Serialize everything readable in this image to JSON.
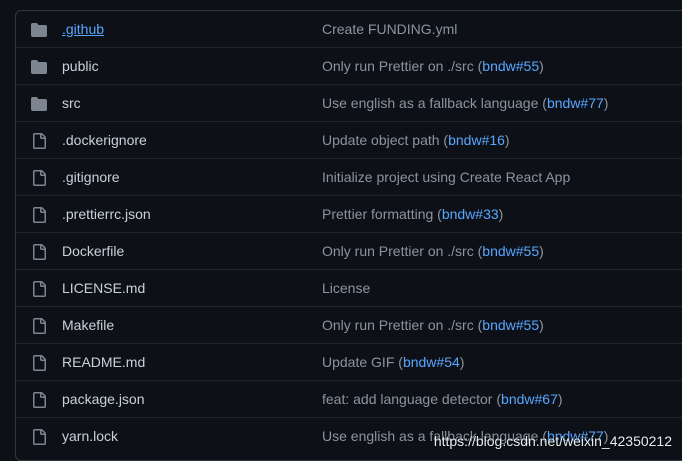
{
  "colors": {
    "background": "#0d1117",
    "border": "#30363d",
    "text": "#c9d1d9",
    "muted": "#8b949e",
    "link": "#58a6ff",
    "folder_icon": "#7d8590"
  },
  "files": [
    {
      "name": "github_dot",
      "label": ".github",
      "type": "folder",
      "commit": "Create FUNDING.yml",
      "pr": "",
      "hover": true
    },
    {
      "name": "public",
      "label": "public",
      "type": "folder",
      "commit": "Only run Prettier on ./src",
      "pr": "bndw#55"
    },
    {
      "name": "src",
      "label": "src",
      "type": "folder",
      "commit": "Use english as a fallback language",
      "pr": "bndw#77"
    },
    {
      "name": "dockerignore",
      "label": ".dockerignore",
      "type": "file",
      "commit": "Update object path",
      "pr": "bndw#16"
    },
    {
      "name": "gitignore",
      "label": ".gitignore",
      "type": "file",
      "commit": "Initialize project using Create React App",
      "pr": ""
    },
    {
      "name": "prettierrc",
      "label": ".prettierrc.json",
      "type": "file",
      "commit": "Prettier formatting",
      "pr": "bndw#33"
    },
    {
      "name": "dockerfile",
      "label": "Dockerfile",
      "type": "file",
      "commit": "Only run Prettier on ./src",
      "pr": "bndw#55"
    },
    {
      "name": "license",
      "label": "LICENSE.md",
      "type": "file",
      "commit": "License",
      "pr": ""
    },
    {
      "name": "makefile",
      "label": "Makefile",
      "type": "file",
      "commit": "Only run Prettier on ./src",
      "pr": "bndw#55"
    },
    {
      "name": "readme",
      "label": "README.md",
      "type": "file",
      "commit": "Update GIF",
      "pr": "bndw#54"
    },
    {
      "name": "package",
      "label": "package.json",
      "type": "file",
      "commit": "feat: add language detector",
      "pr": "bndw#67"
    },
    {
      "name": "yarnlock",
      "label": "yarn.lock",
      "type": "file",
      "commit": "Use english as a fallback language",
      "pr": "bndw#77"
    }
  ],
  "icons": {
    "folder": "folder-icon",
    "file": "file-icon"
  },
  "watermark": "https://blog.csdn.net/weixin_42350212"
}
